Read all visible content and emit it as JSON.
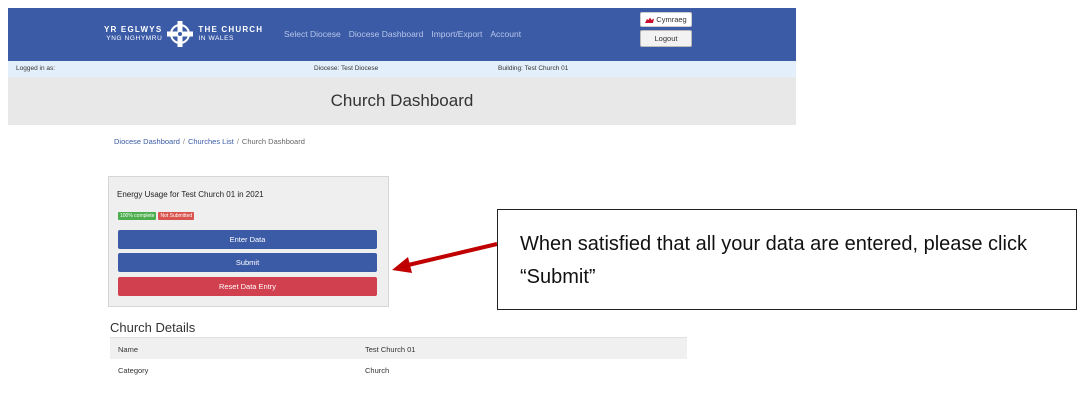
{
  "header": {
    "logo": {
      "left_top": "YR EGLWYS",
      "left_bottom": "YNG NGHYMRU",
      "right_top": "THE CHURCH",
      "right_bottom": "IN WALES"
    },
    "nav": [
      "Select Diocese",
      "Diocese Dashboard",
      "Import/Export",
      "Account"
    ],
    "language_button": "Cymraeg",
    "logout_button": "Logout"
  },
  "infobar": {
    "logged_in": "Logged in as:",
    "diocese": "Diocese: Test Diocese",
    "building": "Building: Test Church 01"
  },
  "page_title": "Church Dashboard",
  "breadcrumb": {
    "items": [
      "Diocese Dashboard",
      "Churches List",
      "Church Dashboard"
    ],
    "separator": "/"
  },
  "energy_card": {
    "title": "Energy Usage for Test Church 01 in 2021",
    "badges": [
      "100% complete",
      "Not Submitted"
    ],
    "enter_button": "Enter Data",
    "submit_button": "Submit",
    "reset_button": "Reset Data Entry"
  },
  "details": {
    "title": "Church Details",
    "rows": [
      {
        "key": "Name",
        "value": "Test Church 01"
      },
      {
        "key": "Category",
        "value": "Church"
      }
    ]
  },
  "callout": {
    "text": "When satisfied that all your data are entered, please click “Submit”"
  },
  "colors": {
    "nav_blue": "#3b5ba7",
    "button_red": "#d0404f",
    "badge_green": "#4cae4c",
    "arrow_red": "#c00000"
  }
}
